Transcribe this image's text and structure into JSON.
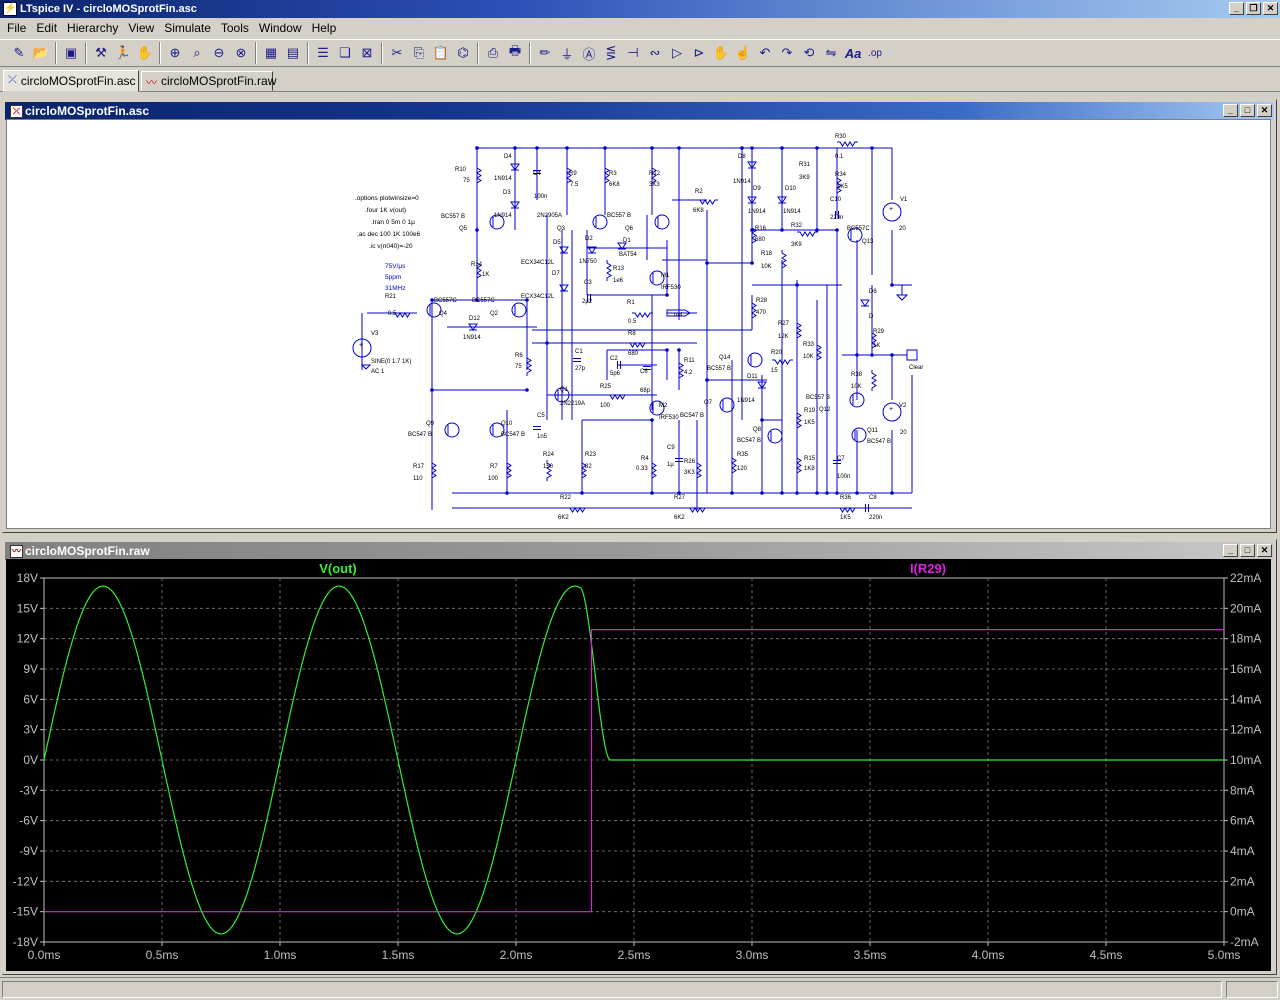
{
  "app": {
    "title": "LTspice IV - circloMOSprotFin.asc",
    "icon": "ltspice-logo-icon"
  },
  "menu": [
    "File",
    "Edit",
    "Hierarchy",
    "View",
    "Simulate",
    "Tools",
    "Window",
    "Help"
  ],
  "toolbar_icons": [
    "new-schematic-icon",
    "open-icon",
    "save-icon",
    "control-panel-icon",
    "run-icon",
    "halt-icon",
    "zoom-in-icon",
    "zoom-pan-icon",
    "zoom-out-icon",
    "zoom-fit-icon",
    "autoscale-icon",
    "tile-icon",
    "cascade-icon",
    "close-window-icon",
    "cut-icon",
    "copy-icon",
    "paste-icon",
    "find-icon",
    "print-setup-icon",
    "print-icon",
    "wire-icon",
    "ground-icon",
    "label-icon",
    "resistor-icon",
    "capacitor-icon",
    "inductor-icon",
    "diode-icon",
    "component-icon",
    "move-icon",
    "drag-icon",
    "undo-icon",
    "redo-icon",
    "rotate-icon",
    "mirror-icon",
    "text-icon",
    "spice-directive-icon"
  ],
  "tabs": [
    {
      "label": "circloMOSprotFin.asc",
      "icon": "schematic-icon",
      "active": true
    },
    {
      "label": "circloMOSprotFin.raw",
      "icon": "waveform-icon",
      "active": false
    }
  ],
  "schematic_window": {
    "title": "circloMOSprotFin.asc",
    "directives": [
      ".options plotwinsize=0",
      ".four 1K v(out)",
      ".tran 0 5m 0 1μ",
      ";ac dec 100 1K 100e6",
      ".ic v(n040)=-20"
    ],
    "notes": [
      "75V/μs",
      "5ppm",
      "31MHz"
    ],
    "labels": {
      "r10": "R10",
      "r10v": "75",
      "d4": "D4",
      "d4m": "1N914",
      "c4": "C4",
      "c4v": "100n",
      "r9": "R9",
      "r9v": "7.5",
      "r3": "R3",
      "r3v": "6K8",
      "r12": "R12",
      "r12v": "3K3",
      "d3": "D3",
      "d3m": "1N914",
      "q5": "Q5",
      "q5m": "BC557 B",
      "q3m": "2N2905A",
      "q3": "Q3",
      "q6": "Q6",
      "q6m": "BC557 B",
      "r2": "R2",
      "r2v": "6K8",
      "d5": "D5",
      "d2": "D2",
      "d2m": "1N750",
      "d1": "D1",
      "d1m": "BAT54",
      "d6m": "ECX34C12L",
      "r13": "R13",
      "r13v": "1e6",
      "m1": "M1",
      "m1m": "IRF530",
      "r14": "R14",
      "r14v": "1K",
      "d7": "D7",
      "d7m": "ECX34C12L",
      "c3": "C3",
      "c3v": "2μ2",
      "r1": "R1",
      "r1v": "0.5",
      "out": "out",
      "r21": "R21",
      "r21v": "0.5",
      "q4": "Q4",
      "q4m": "BC557C",
      "q2": "Q2",
      "q2m": "BC557C",
      "d12": "D12",
      "d12m": "1N914",
      "v3": "V3",
      "v3s": "SINE(0 1.7 1K)",
      "v3ac": "AC 1",
      "r8": "R8",
      "r8v": "680",
      "c1": "C1",
      "c1v": "27p",
      "c2": "C2",
      "c2v": "5p6",
      "c6": "C6",
      "c6v": "68p",
      "r11": "R11",
      "r11v": "4.2",
      "r6": "R6",
      "r6v": "75",
      "q1": "Q1",
      "q1m": "2N2219A",
      "r25": "R25",
      "r25v": "100",
      "m2": "M2",
      "m2m": "IRF530",
      "c5": "C5",
      "c5v": "1n5",
      "q9": "Q9",
      "q9m": "BC547 B",
      "q10": "Q10",
      "q10m": "BC547 B",
      "r17": "R17",
      "r17v": "110",
      "r7": "R7",
      "r7v": "100",
      "r24": "R24",
      "r24v": "150",
      "r23": "R23",
      "r23v": "82",
      "r22": "R22",
      "r22v": "6K2",
      "r4": "R4",
      "r4v": "0.33",
      "c9": "C9",
      "c9v": "1μ",
      "r26": "R26",
      "r26v": "3K3",
      "r27": "R27",
      "r27v": "6K2",
      "d8": "D8",
      "d8m": "1N914",
      "d9": "D9",
      "d9m": "1N914",
      "d10": "D10",
      "d10m": "1N914",
      "r31": "R31",
      "r31v": "3K9",
      "r30": "R30",
      "r30v": "0.1",
      "r34": "R34",
      "r34v": "1K5",
      "c10": "C10",
      "c10v": "220n",
      "r16": "R16",
      "r16v": "680",
      "r32": "R32",
      "r32v": "3K9",
      "q13": "Q13",
      "q13m": "BC557C",
      "v1": "V1",
      "v1v": "20",
      "r18": "R18",
      "r18v": "10K",
      "r28": "R28",
      "r28v": "470",
      "d8b": "D8",
      "d8bm": "D",
      "r29": "R29",
      "r29v": "1K",
      "r27b": "R27",
      "r27bv": "12K",
      "r33": "R33",
      "r33v": "10K",
      "clear": "Clear",
      "q14": "Q14",
      "q14m": "BC557 B",
      "r20": "R20",
      "r20v": "15",
      "d11": "D11",
      "d11m": "1N914",
      "q7": "Q7",
      "q7m": "BC547 B",
      "q8": "Q8",
      "q8m": "BC547 B",
      "r35": "R35",
      "r35v": "120",
      "r19": "R19",
      "r19v": "1K5",
      "r15": "R15",
      "r15v": "1K8",
      "q12": "Q12",
      "q12m": "BC557 B",
      "r38": "R38",
      "r38v": "10K",
      "q11": "Q11",
      "q11m": "BC547 B",
      "v2": "V2",
      "v2v": "20",
      "c7": "C7",
      "c7v": "100n",
      "r36": "R36",
      "r36v": "1K5",
      "c8": "C8",
      "c8v": "220n"
    }
  },
  "plot_window": {
    "title": "circloMOSprotFin.raw",
    "colors": {
      "bg": "#000000",
      "vout": "#33ee33",
      "ir29": "#dd22dd",
      "grid": "#808080",
      "axis": "#c0c0c0"
    },
    "chart_data": {
      "type": "line",
      "x_ticks": [
        "0.0ms",
        "0.5ms",
        "1.0ms",
        "1.5ms",
        "2.0ms",
        "2.5ms",
        "3.0ms",
        "3.5ms",
        "4.0ms",
        "4.5ms",
        "5.0ms"
      ],
      "y_left_ticks": [
        "18V",
        "15V",
        "12V",
        "9V",
        "6V",
        "3V",
        "0V",
        "-3V",
        "-6V",
        "-9V",
        "-12V",
        "-15V",
        "-18V"
      ],
      "y_right_ticks": [
        "22mA",
        "20mA",
        "18mA",
        "16mA",
        "14mA",
        "12mA",
        "10mA",
        "8mA",
        "6mA",
        "4mA",
        "2mA",
        "0mA",
        "-2mA"
      ],
      "xlim_ms": [
        0,
        5
      ],
      "ylim_left_V": [
        -18,
        18
      ],
      "ylim_right_mA": [
        -2,
        22
      ],
      "series": [
        {
          "name": "V(out)",
          "axis": "left",
          "amplitude_V": 17.2,
          "freq_kHz": 1,
          "clamp_start_ms": 2.27,
          "clamp_end_ms": 2.4,
          "final_V": 0
        },
        {
          "name": "I(R29)",
          "axis": "right",
          "x_ms": [
            0,
            2.32,
            2.32,
            5
          ],
          "y_mA": [
            0,
            0,
            18.6,
            18.6
          ]
        }
      ]
    }
  }
}
